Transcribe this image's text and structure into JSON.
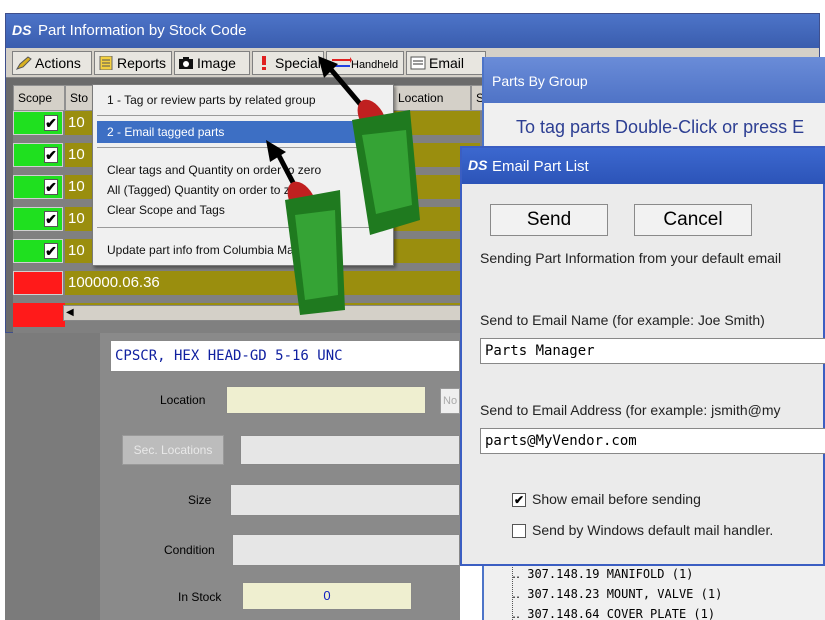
{
  "main_window": {
    "logo": "DS",
    "title": "Part Information by Stock Code"
  },
  "toolbar": {
    "actions": "Actions",
    "reports": "Reports",
    "image": "Image",
    "special": "Special",
    "handheld": "Handheld",
    "email": "Email"
  },
  "grid": {
    "headers": [
      "Scope",
      "Sto",
      "Location",
      "S"
    ],
    "rows": [
      {
        "stock": "10",
        "scope_color": "#1fe01f",
        "checked": true
      },
      {
        "stock": "10",
        "scope_color": "#1fe01f",
        "checked": true
      },
      {
        "stock": "10",
        "scope_color": "#1fe01f",
        "checked": true
      },
      {
        "stock": "10",
        "scope_color": "#1fe01f",
        "checked": true
      },
      {
        "stock": "10",
        "scope_color": "#1fe01f",
        "checked": true
      },
      {
        "stock": "100000.06.36",
        "scope_color": "#ff1a1a",
        "checked": false
      }
    ],
    "row_color": "#9a8e0e"
  },
  "menu": {
    "items": [
      "1 - Tag or review parts by related group",
      "2 - Email tagged parts",
      "Clear tags and Quantity on order to zero",
      "All (Tagged) Quantity on order to zero",
      "Clear Scope and Tags",
      "Update part info from Columbia Machine Inc"
    ]
  },
  "detail": {
    "description": "CPSCR, HEX HEAD-GD 5-16 UNC",
    "location_label": "Location",
    "sec_locations": "Sec. Locations",
    "size_label": "Size",
    "condition_label": "Condition",
    "in_stock_label": "In Stock",
    "in_stock_value": "0",
    "no_label": "No"
  },
  "parts_by_group": {
    "title": "Parts By Group",
    "hint": "To tag parts Double-Click or press E",
    "tree": [
      "307.148.19  MANIFOLD  (1)",
      "307.148.23  MOUNT, VALVE  (1)",
      "307.148.64  COVER PLATE  (1)"
    ]
  },
  "email_dialog": {
    "logo": "DS",
    "title": "Email Part List",
    "send": "Send",
    "cancel": "Cancel",
    "info": "Sending Part Information from your default email",
    "name_label": "Send to Email Name (for example: Joe Smith)",
    "name_value": "Parts Manager",
    "address_label": "Send to Email Address (for example: jsmith@my",
    "address_value": "parts@MyVendor.com",
    "show_before_sending": "Show email before sending",
    "show_before_sending_checked": true,
    "default_mail_handler": "Send by Windows default mail handler.",
    "default_mail_handler_checked": false
  }
}
